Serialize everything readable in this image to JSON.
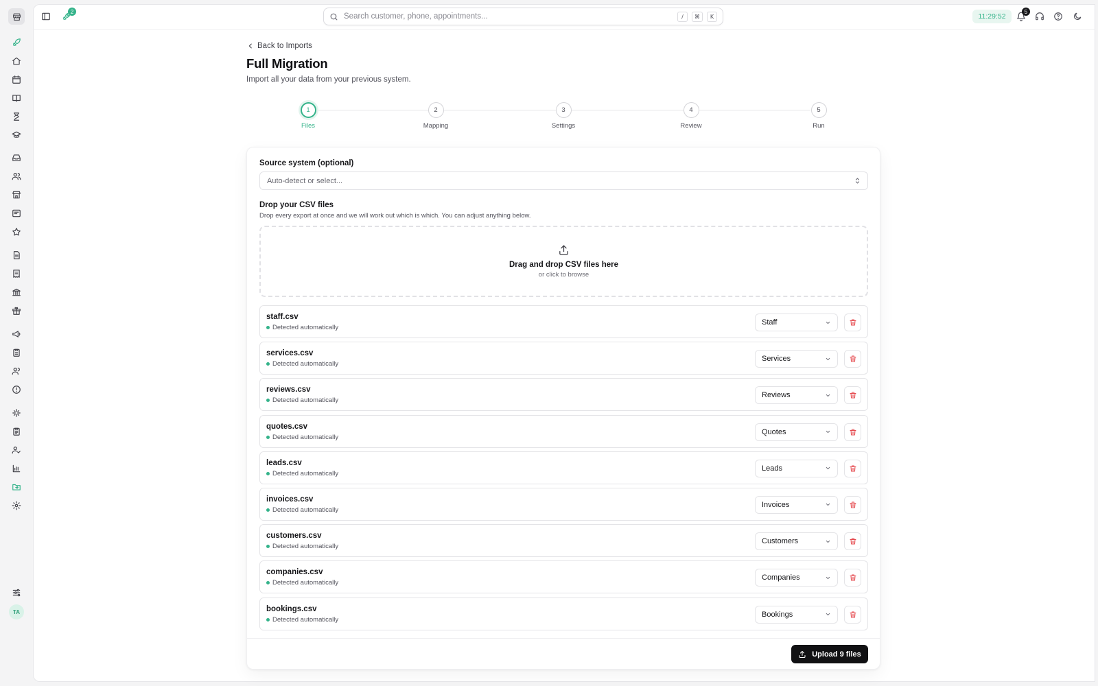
{
  "colors": {
    "accent": "#34b38a",
    "danger": "#e5484d",
    "primary_button": "#111113"
  },
  "sidebar": {
    "icons": [
      "rocket-icon",
      "home-icon",
      "calendar-icon",
      "book-icon",
      "hourglass-icon",
      "graduation-cap-icon",
      "inbox-icon",
      "users-icon",
      "store-icon",
      "form-icon",
      "star-icon",
      "file-text-icon",
      "receipt-icon",
      "bank-icon",
      "gift-icon",
      "megaphone-icon",
      "clipboard-icon",
      "team-icon",
      "alert-circle-icon",
      "sparkle-icon",
      "clipboard-list-icon",
      "user-check-icon",
      "bar-chart-icon",
      "folder-import-icon",
      "settings-icon",
      "sliders-icon"
    ],
    "avatar_initials": "TA"
  },
  "topbar": {
    "rocket_badge": "2",
    "search_placeholder": "Search customer, phone, appointments...",
    "shortcut_slash": "/",
    "shortcut_cmd": "⌘",
    "shortcut_k": "K",
    "clock": "11:29:52",
    "notifications_count": "5"
  },
  "page": {
    "back_label": "Back to Imports",
    "title": "Full Migration",
    "subtitle": "Import all your data from your previous system."
  },
  "stepper": {
    "steps": [
      {
        "number": "1",
        "label": "Files",
        "active": true
      },
      {
        "number": "2",
        "label": "Mapping"
      },
      {
        "number": "3",
        "label": "Settings"
      },
      {
        "number": "4",
        "label": "Review"
      },
      {
        "number": "5",
        "label": "Run"
      }
    ]
  },
  "form": {
    "source_label": "Source system (optional)",
    "source_placeholder": "Auto-detect or select...",
    "drop_title": "Drop your CSV files",
    "drop_hint": "Drop every export at once and we will work out which is which. You can adjust anything below.",
    "dropzone_main": "Drag and drop CSV files here",
    "dropzone_sub": "or click to browse"
  },
  "files": [
    {
      "name": "staff.csv",
      "status": "Detected automatically",
      "type": "Staff"
    },
    {
      "name": "services.csv",
      "status": "Detected automatically",
      "type": "Services"
    },
    {
      "name": "reviews.csv",
      "status": "Detected automatically",
      "type": "Reviews"
    },
    {
      "name": "quotes.csv",
      "status": "Detected automatically",
      "type": "Quotes"
    },
    {
      "name": "leads.csv",
      "status": "Detected automatically",
      "type": "Leads"
    },
    {
      "name": "invoices.csv",
      "status": "Detected automatically",
      "type": "Invoices"
    },
    {
      "name": "customers.csv",
      "status": "Detected automatically",
      "type": "Customers"
    },
    {
      "name": "companies.csv",
      "status": "Detected automatically",
      "type": "Companies"
    },
    {
      "name": "bookings.csv",
      "status": "Detected automatically",
      "type": "Bookings"
    }
  ],
  "footer": {
    "upload_label": "Upload 9 files"
  }
}
